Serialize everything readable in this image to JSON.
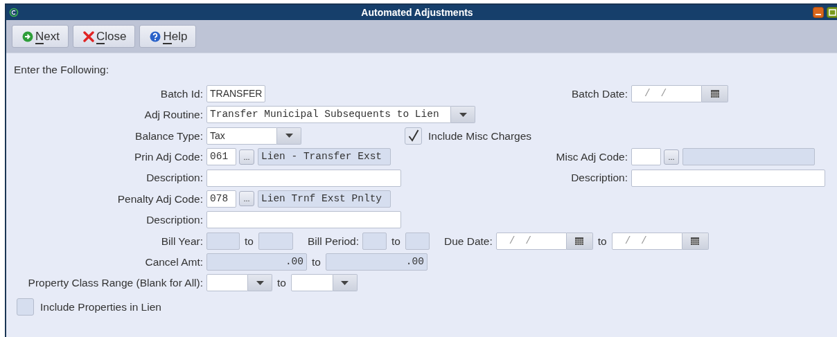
{
  "window": {
    "title": "Automated Adjustments"
  },
  "toolbar": [
    {
      "label": "Next",
      "kind": "next",
      "underline_first": true
    },
    {
      "label": "Close",
      "kind": "close",
      "underline_first": true
    },
    {
      "label": "Help",
      "kind": "help",
      "underline_first": true
    }
  ],
  "form": {
    "heading": "Enter the Following:",
    "batch_id": {
      "label": "Batch Id:",
      "value": "TRANSFER"
    },
    "batch_date": {
      "label": "Batch Date:",
      "placeholder": "/  /"
    },
    "adj_routine": {
      "label": "Adj Routine:",
      "value": "Transfer Municipal Subsequents to Lien"
    },
    "balance_type": {
      "label": "Balance Type:",
      "value": "Tax"
    },
    "include_misc_charges": {
      "label": "Include Misc Charges",
      "checked": true
    },
    "prin_adj_code": {
      "label": "Prin Adj Code:",
      "code": "061",
      "lookup": "...",
      "name": "Lien - Transfer Exst"
    },
    "misc_adj_code": {
      "label": "Misc Adj Code:",
      "lookup": "..."
    },
    "prin_description": {
      "label": "Description:"
    },
    "misc_description": {
      "label": "Description:"
    },
    "penalty_adj_code": {
      "label": "Penalty Adj Code:",
      "code": "078",
      "lookup": "...",
      "name": "Lien Trnf Exst Pnlty"
    },
    "penalty_description": {
      "label": "Description:"
    },
    "bill_year": {
      "label": "Bill Year:",
      "to_label": "to",
      "disabled": true
    },
    "bill_period": {
      "label": "Bill Period:",
      "to_label": "to",
      "disabled": true
    },
    "due_date": {
      "label": "Due Date:",
      "from_placeholder": "/  /",
      "to_label": "to",
      "to_placeholder": "/  /"
    },
    "cancel_amt": {
      "label": "Cancel Amt:",
      "from": ".00",
      "to_label": "to",
      "to": ".00",
      "disabled": true
    },
    "property_class": {
      "label": "Property Class Range (Blank for All):",
      "to_label": "to"
    },
    "include_properties_in_lien": {
      "label": "Include Properties in Lien",
      "checked": false
    }
  }
}
